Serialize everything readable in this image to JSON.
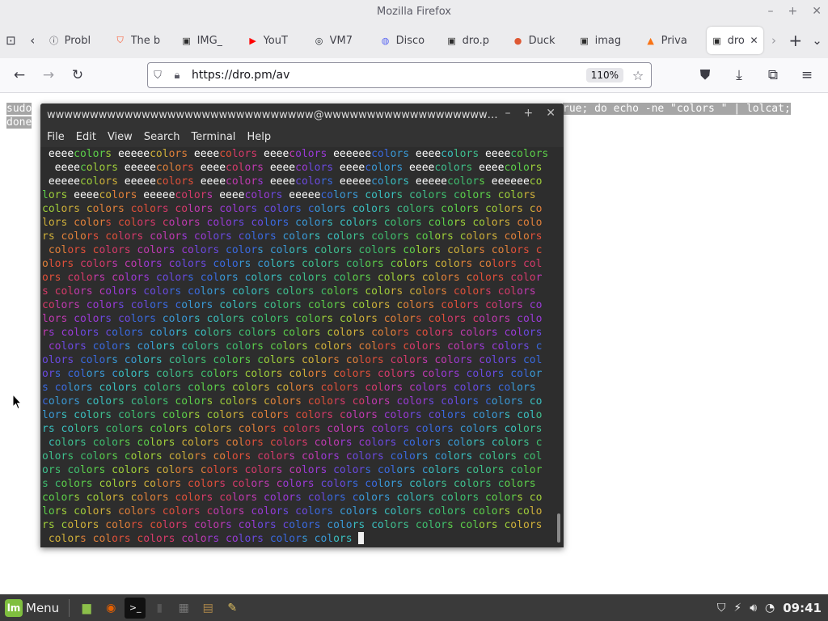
{
  "window": {
    "title": "Mozilla Firefox",
    "controls": [
      "–",
      "+",
      "✕"
    ]
  },
  "tabs": [
    {
      "label": "Probl",
      "icon": "info-icon",
      "color": "#43434b"
    },
    {
      "label": "The b",
      "icon": "brave-lion-icon",
      "color": "#fb542b"
    },
    {
      "label": "IMG_",
      "icon": "terminal-favicon-icon",
      "color": "#2b2b2b"
    },
    {
      "label": "YouT",
      "icon": "youtube-icon",
      "color": "#ff0000"
    },
    {
      "label": "VM7",
      "icon": "github-octocat-icon",
      "color": "#24292e"
    },
    {
      "label": "Disco",
      "icon": "discord-icon",
      "color": "#5865f2"
    },
    {
      "label": "dro.p",
      "icon": "terminal-favicon-icon",
      "color": "#2b2b2b"
    },
    {
      "label": "Duck",
      "icon": "duckduckgo-icon",
      "color": "#de5833"
    },
    {
      "label": "imag",
      "icon": "terminal-favicon-icon",
      "color": "#2b2b2b"
    },
    {
      "label": "Priva",
      "icon": "privacy-icon",
      "color": "#f97316"
    },
    {
      "label": "dro",
      "icon": "terminal-favicon-icon",
      "color": "#2b2b2b",
      "active": true
    }
  ],
  "toolbar": {
    "url": "https://dro.pm/av",
    "zoom": "110%"
  },
  "page": {
    "line1_left": "sudo",
    "line1_right": "rue; do echo -ne \"colors \" | lolcat;",
    "line2": "done"
  },
  "terminal": {
    "title": "wwwwwwwwwwwwwwwwwwwwwwwwwwwwwww@wwwwwwwwwwwwwwwwwwwwwwww...",
    "controls": [
      "–",
      "+",
      "✕"
    ],
    "menu": [
      "File",
      "Edit",
      "View",
      "Search",
      "Terminal",
      "Help"
    ],
    "palette": [
      "#3fbf6f",
      "#5ccf4a",
      "#9fcf3a",
      "#cfb03a",
      "#e0803a",
      "#e0503a",
      "#d63a6a",
      "#c03ab0",
      "#9a3ad6",
      "#6a4ae0",
      "#3a6ae0",
      "#3a9ad6",
      "#3abfbf",
      "#3fbf8f"
    ],
    "lines": [
      " eeeecolors eeeeecolors eeeecolors eeeecolors eeeeeecolors eeeecolors eeeecolors",
      "  eeeecolors eeeeecolors eeeecolors eeeecolors eeeecolors eeeecolors eeeecolors",
      " eeeeecolors eeeeecolors eeeecolors eeeecolors eeeeecolors eeeeecolors eeeeeeco",
      "lors eeeecolors eeeeecolors eeeecolors eeeeecolors colors colors colors colors ",
      "colors colors colors colors colors colors colors colors colors colors colors co",
      "lors colors colors colors colors colors colors colors colors colors colors colo",
      "rs colors colors colors colors colors colors colors colors colors colors colors",
      " colors colors colors colors colors colors colors colors colors colors colors c",
      "olors colors colors colors colors colors colors colors colors colors colors col",
      "ors colors colors colors colors colors colors colors colors colors colors color",
      "s colors colors colors colors colors colors colors colors colors colors colors ",
      "colors colors colors colors colors colors colors colors colors colors colors co",
      "lors colors colors colors colors colors colors colors colors colors colors colo",
      "rs colors colors colors colors colors colors colors colors colors colors colors",
      " colors colors colors colors colors colors colors colors colors colors colors c",
      "olors colors colors colors colors colors colors colors colors colors colors col",
      "ors colors colors colors colors colors colors colors colors colors colors color",
      "s colors colors colors colors colors colors colors colors colors colors colors ",
      "colors colors colors colors colors colors colors colors colors colors colors co",
      "lors colors colors colors colors colors colors colors colors colors colors colo",
      "rs colors colors colors colors colors colors colors colors colors colors colors",
      " colors colors colors colors colors colors colors colors colors colors colors c",
      "olors colors colors colors colors colors colors colors colors colors colors col",
      "ors colors colors colors colors colors colors colors colors colors colors color",
      "s colors colors colors colors colors colors colors colors colors colors colors ",
      "colors colors colors colors colors colors colors colors colors colors colors co",
      "lors colors colors colors colors colors colors colors colors colors colors colo",
      "rs colors colors colors colors colors colors colors colors colors colors colors",
      " colors colors colors colors colors colors colors "
    ]
  },
  "taskbar": {
    "menu_label": "Menu",
    "launchers": [
      {
        "name": "files-icon",
        "glyph": "▆",
        "color": "#8cbf4a"
      },
      {
        "name": "firefox-icon",
        "glyph": "◉",
        "color": "#e66000"
      },
      {
        "name": "terminal-icon",
        "glyph": ">_",
        "color": "#222222"
      },
      {
        "name": "text-editor-icon",
        "glyph": "▮",
        "color": "#555555"
      },
      {
        "name": "calculator-icon",
        "glyph": "▦",
        "color": "#777777"
      },
      {
        "name": "archive-icon",
        "glyph": "▤",
        "color": "#b08a4a"
      },
      {
        "name": "notes-icon",
        "glyph": "✎",
        "color": "#e0c060"
      }
    ],
    "clock": "09:41"
  }
}
